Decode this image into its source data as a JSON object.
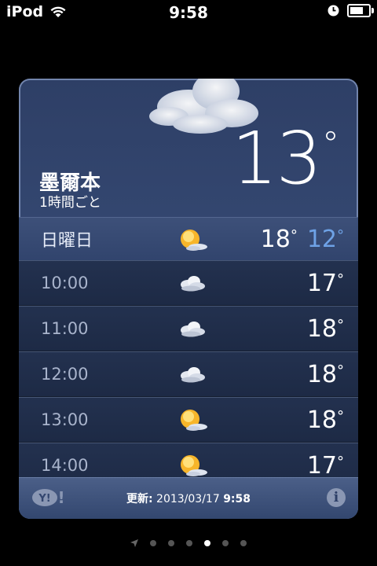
{
  "status_bar": {
    "carrier": "iPod",
    "time": "9:58"
  },
  "weather": {
    "city": "墨爾本",
    "interval": "1時間ごと",
    "current_temp": "13",
    "degree": "°",
    "day": {
      "label": "日曜日",
      "icon": "sun-with-cloud-icon",
      "high": "18",
      "low": "12"
    },
    "hours": [
      {
        "time": "10:00",
        "icon": "cloud-icon",
        "temp": "17"
      },
      {
        "time": "11:00",
        "icon": "cloud-icon",
        "temp": "18"
      },
      {
        "time": "12:00",
        "icon": "cloud-icon",
        "temp": "18"
      },
      {
        "time": "13:00",
        "icon": "sun-with-cloud-icon",
        "temp": "18"
      },
      {
        "time": "14:00",
        "icon": "sun-with-cloud-icon",
        "temp": "17"
      }
    ]
  },
  "footer": {
    "provider": "Y!",
    "updated_label": "更新:",
    "updated_date": "2013/03/17",
    "updated_time": "9:58",
    "info": "i"
  },
  "page_dots": {
    "count": 6,
    "active_index": 4
  },
  "colors": {
    "low_temp": "#6ea2e6",
    "card_top": "#2e3f66",
    "hour_row": "#23314f"
  }
}
